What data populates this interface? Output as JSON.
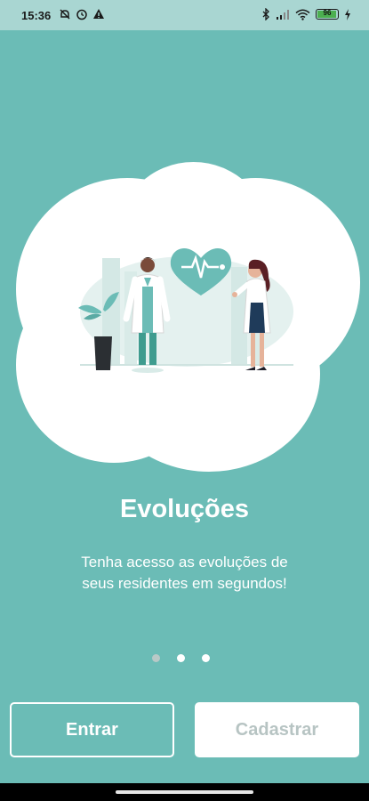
{
  "status_bar": {
    "time": "15:36",
    "left_icons": [
      "alarm-off-icon",
      "alarm-icon",
      "warning-icon"
    ],
    "right_icons": [
      "bluetooth-icon",
      "signal-icon",
      "wifi-icon",
      "battery-icon",
      "charging-icon"
    ],
    "battery_level": "96",
    "battery_color": "#4caf50"
  },
  "colors": {
    "background": "#6bbcb6",
    "status_bar": "#a9d6d2",
    "accent": "#6bbcb6",
    "register_text": "#b7c4c3"
  },
  "onboarding": {
    "title": "Evoluções",
    "description_lines": [
      "Tenha acesso as evoluções de",
      "seus residentes em segundos!"
    ],
    "page_index": 1,
    "page_count": 3
  },
  "actions": {
    "login_label": "Entrar",
    "register_label": "Cadastrar"
  }
}
